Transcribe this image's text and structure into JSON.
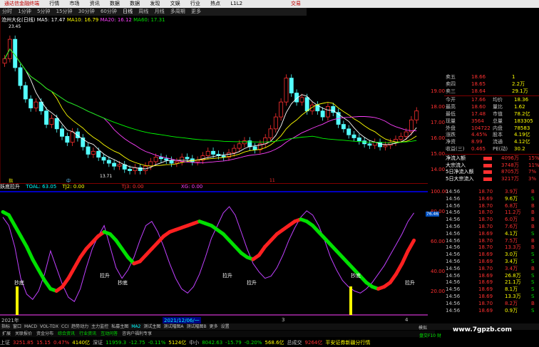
{
  "menubar": {
    "app_title": "通达信金融终端",
    "items": [
      "行情",
      "市场",
      "资讯",
      "数据",
      "数据",
      "发现",
      "文娱",
      "行业",
      "热点",
      "L1L2"
    ],
    "trade_label": "交易"
  },
  "period_tabs": {
    "items": [
      "分时",
      "1分钟",
      "5分钟",
      "15分钟",
      "30分钟",
      "60分钟",
      "日线",
      "周线",
      "月线",
      "多周期",
      "更多"
    ],
    "selected": "日线"
  },
  "chart": {
    "stock_label": "沧州大化(日线)",
    "ma": [
      {
        "name": "MA5",
        "value": "17.47",
        "color": "#ffffff"
      },
      {
        "name": "MA10",
        "value": "16.79",
        "color": "#ffff00"
      },
      {
        "name": "MA20",
        "value": "16.12",
        "color": "#ff40ff"
      },
      {
        "name": "MA60",
        "value": "17.31",
        "color": "#00ff00"
      }
    ],
    "high_label": "23.45",
    "low_label": "13.71",
    "price_ticks": [
      "19.00",
      "18.00",
      "17.00",
      "16.00",
      "15.00",
      "14.00"
    ],
    "small_tags": [
      "指",
      "中",
      "11"
    ]
  },
  "chart_data": {
    "type": "line",
    "price_ylim": [
      13.5,
      24
    ],
    "closes": [
      21.5,
      22.8,
      20.9,
      19.7,
      18.8,
      18.2,
      18.6,
      18.0,
      17.1,
      17.5,
      16.8,
      16.3,
      15.9,
      16.6,
      16.2,
      15.6,
      15.1,
      15.3,
      14.9,
      14.7,
      14.5,
      14.3,
      14.4,
      14.1,
      14.0,
      14.2,
      14.0,
      14.3,
      14.6,
      14.9,
      14.8,
      14.7,
      14.5,
      14.6,
      14.9,
      14.8,
      14.6,
      14.7,
      15.0,
      15.3,
      15.1,
      15.0,
      14.9,
      15.2,
      15.5,
      15.8,
      16.0,
      15.6,
      15.4,
      15.8,
      16.2,
      16.8,
      17.6,
      18.6,
      20.2,
      19.2,
      18.6,
      18.9,
      18.0,
      18.4,
      18.0,
      17.6,
      18.3,
      17.9,
      17.1,
      16.8,
      16.4,
      16.2,
      16.0,
      15.8,
      15.7,
      15.9,
      15.6,
      15.7,
      15.9,
      16.1,
      16.3,
      16.6,
      17.4,
      18.0
    ],
    "indicator_ylim": [
      0,
      100
    ],
    "indicator": [
      93,
      90,
      80,
      70,
      60,
      48,
      38,
      28,
      20,
      18,
      22,
      30,
      40,
      50,
      58,
      64,
      70,
      74,
      72,
      66,
      58,
      50,
      44,
      46,
      52,
      58,
      64,
      70,
      74,
      76,
      78,
      80,
      82,
      84,
      82,
      80,
      76,
      72,
      66,
      60,
      54,
      50,
      48,
      52,
      60,
      66,
      72,
      76,
      80,
      84,
      86,
      84,
      80,
      74,
      68,
      62,
      56,
      50,
      44,
      38,
      32,
      26,
      22,
      20,
      22,
      26,
      34,
      44,
      56,
      66
    ],
    "osc_line": [
      88,
      80,
      60,
      30,
      15,
      10,
      18,
      34,
      56,
      40,
      24,
      12,
      8,
      20,
      40,
      58,
      70,
      80,
      60,
      40,
      30,
      38,
      50,
      66,
      80,
      84,
      74,
      60,
      44,
      30,
      20,
      16,
      22,
      34,
      50,
      68,
      80,
      92,
      98,
      90,
      74,
      58,
      44,
      36,
      30,
      32,
      40,
      52,
      66,
      78,
      88,
      94,
      90,
      80,
      66,
      50,
      38,
      28,
      22,
      18,
      16,
      20,
      26,
      34,
      42,
      52,
      62,
      72,
      84,
      92
    ],
    "signals": [
      "抄底",
      "拉升",
      "抄底",
      "拉升",
      "拉升",
      "抄底",
      "拉升"
    ],
    "indicator_ticks": [
      "100.00",
      "80.00",
      "60.00",
      "40.00",
      "20.00"
    ],
    "current_value": "76.46"
  },
  "indicator_header": {
    "name": "妖底拉升",
    "tokens": [
      {
        "text": "TOAL: 63.05",
        "color": "#00ffff"
      },
      {
        "text": "TJ2: 0.00",
        "color": "#ffff00"
      },
      {
        "text": "TJ3: 0.00",
        "color": "#ff3030"
      },
      {
        "text": "XG: 0.00",
        "color": "#ff40ff"
      }
    ]
  },
  "quote": {
    "asks": [
      {
        "label": "卖五",
        "price": "18.66",
        "vol": "1"
      },
      {
        "label": "卖四",
        "price": "18.65",
        "vol": "2.2万"
      },
      {
        "label": "卖三",
        "price": "18.64",
        "vol": "29.1万"
      }
    ],
    "stats": [
      [
        "今开",
        "17.66",
        "均价",
        "18.36"
      ],
      [
        "最高",
        "18.60",
        "量比",
        "1.62"
      ],
      [
        "最低",
        "17.48",
        "市值",
        "78.2亿"
      ],
      [
        "现量",
        "3564",
        "总量",
        "183305"
      ],
      [
        "外盘",
        "104722",
        "内盘",
        "78583"
      ],
      [
        "涨跌",
        "4.45%",
        "股本",
        "4.19亿"
      ],
      [
        "净资",
        "8.99",
        "流通",
        "4.12亿"
      ],
      [
        "收益(三)",
        "0.465",
        "PE(动)",
        "30.2"
      ]
    ],
    "flows": [
      {
        "label": "净流入额",
        "value": "4096万",
        "pct": "15%"
      },
      {
        "label": "大宗流入",
        "value": "3748万",
        "pct": "11%"
      },
      {
        "label": "5日净流入额",
        "value": "8705万",
        "pct": "7%"
      },
      {
        "label": "5日大宗流入",
        "value": "3217万",
        "pct": "3%"
      }
    ]
  },
  "trades": [
    [
      "14:56",
      "18.70",
      "3.9万",
      "B"
    ],
    [
      "14:56",
      "18.69",
      "9.6万",
      "S"
    ],
    [
      "14:56",
      "18.70",
      "6.8万",
      "B"
    ],
    [
      "14:56",
      "18.70",
      "11.2万",
      "B"
    ],
    [
      "14:56",
      "18.70",
      "6.0万",
      "B"
    ],
    [
      "14:56",
      "18.70",
      "7.6万",
      "B"
    ],
    [
      "14:56",
      "18.69",
      "4.1万",
      "S"
    ],
    [
      "14:56",
      "18.70",
      "7.5万",
      "B"
    ],
    [
      "14:56",
      "18.70",
      "13.3万",
      "B"
    ],
    [
      "14:56",
      "18.69",
      "3.0万",
      "S"
    ],
    [
      "14:56",
      "18.69",
      "3.4万",
      "S"
    ],
    [
      "14:56",
      "18.70",
      "3.4万",
      "B"
    ],
    [
      "14:56",
      "18.69",
      "26.8万",
      "S"
    ],
    [
      "14:56",
      "18.69",
      "21.1万",
      "S"
    ],
    [
      "14:56",
      "18.69",
      "8.1万",
      "S"
    ],
    [
      "14:56",
      "18.69",
      "13.3万",
      "S"
    ],
    [
      "14:56",
      "18.70",
      "8.2万",
      "B"
    ],
    [
      "14:56",
      "18.69",
      "0.9万",
      "S"
    ]
  ],
  "date_axis": [
    "2021年",
    "2021/12/06/一",
    "3",
    "4"
  ],
  "bottom_tabs": {
    "items": [
      "指标",
      "窗口",
      "MACD",
      "VOL-TDX",
      "CCI",
      "趋势动力",
      "主力监控",
      "私募主图",
      "MA2",
      "测试主图",
      "测试幅图A",
      "测试幅图B",
      "更多",
      "设置"
    ],
    "row2": [
      "扩展",
      "关联报价",
      "资金分布",
      "综合资讯",
      "行业资讯",
      "互动问答",
      "咨询户福利专享"
    ],
    "mode_labels": [
      "模拟",
      "盘交F10 财"
    ]
  },
  "indices": [
    {
      "name": "上证",
      "value": "3251.85",
      "chg": "15.15",
      "pct": "0.47%",
      "amt": "4140亿"
    },
    {
      "name": "深证",
      "value": "11959.3",
      "chg": "-12.75",
      "pct": "-0.11%",
      "amt": "5124亿"
    },
    {
      "name": "中小",
      "value": "8042.63",
      "chg": "-15.79",
      "pct": "-0.20%",
      "amt": "568.6亿"
    },
    {
      "name": "总成交",
      "value": "9264亿",
      "chg": "",
      "pct": "",
      "amt": "平安证券新疆分行情"
    }
  ],
  "watermark": "www.7gpzb.com"
}
